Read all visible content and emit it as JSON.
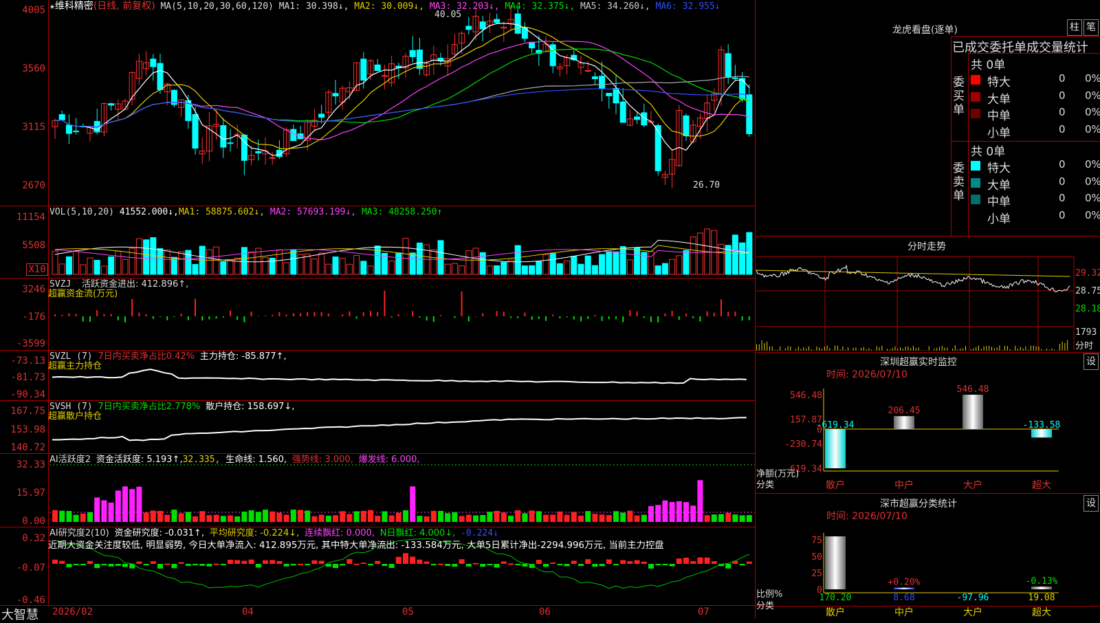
{
  "app": {
    "logo_text": "大智慧"
  },
  "stock": {
    "name": "维科精密",
    "mode": "(日线, 前复权)"
  },
  "price_panel": {
    "ma_params": "MA(5,10,20,30,60,120)",
    "ma1": "MA1: 30.398↓,",
    "ma2": "MA2: 30.009↓,",
    "ma3": "MA3: 32.203↓,",
    "ma4": "MA4: 32.375↓,",
    "ma5": "MA5: 34.260↓,",
    "ma6": "MA6: 32.955↓",
    "high_label": "40.05",
    "low_label": "26.70",
    "y_ticks": [
      "4005",
      "3560",
      "3115",
      "2670"
    ]
  },
  "vol_panel": {
    "title": "VOL(5,10,20)",
    "value": "41552.000↓,",
    "ma1": "MA1: 58875.602↓,",
    "ma2": "MA2: 57693.199↓,",
    "ma3": "MA3: 48258.250↑",
    "y_ticks": [
      "11154",
      "5508"
    ],
    "unit": "X10"
  },
  "svzj_panel": {
    "title": "SVZJ",
    "text": "活跃资金进出: 412.896↑,",
    "subtitle": "超赢资金流(万元)",
    "y_ticks": [
      "3246",
      "-176",
      "-3599"
    ]
  },
  "svzl_panel": {
    "title": "SVZL (7)",
    "ratio": "7日内买卖净占比0.42%",
    "text": "主力持仓: -85.877↑,",
    "subtitle": "超赢主力持仓",
    "y_ticks": [
      "-73.13",
      "-81.73",
      "-90.34"
    ]
  },
  "svsh_panel": {
    "title": "SVSH (7)",
    "ratio": "7日内买卖净占比2.778%",
    "text": "散户持仓: 158.697↓,",
    "subtitle": "超赢散户持仓",
    "y_ticks": [
      "167.75",
      "153.98",
      "140.72"
    ]
  },
  "ai_active_panel": {
    "title": "AI活跃度2",
    "text1": "资金活跃度: 5.193↑,",
    "text2": "32.335,",
    "text3": "生命线: 1.560,",
    "text4": "强势线: 3.000,",
    "text5": "爆发线: 6.000,",
    "y_ticks": [
      "32.33",
      "15.97",
      "0.00"
    ]
  },
  "ai_research_panel": {
    "title": "AI研究度2(10)",
    "text1": "资金研究度: -0.031↑,",
    "text2": "平均研究度: -0.224↓,",
    "text3": "连续飘红: 0.000,",
    "text4": "N日飘红: 4.000↓,",
    "text5": "-0.224↓",
    "commentary": "近期大资金关注度较低, 明显弱势, 今日大单净流入: 412.895万元, 其中特大单净流出: -133.584万元, 大单5日累计净出-2294.996万元, 当前主力控盘",
    "y_ticks": [
      "0.32",
      "-0.07",
      "-0.46"
    ]
  },
  "x_axis": {
    "labels": [
      "2026/02",
      "04",
      "05",
      "06",
      "07"
    ]
  },
  "dragon_tiger": {
    "title": "龙虎看盘(逐单)",
    "btn_bar": "柱",
    "btn_pen": "笔",
    "header": "已成交委托单成交量统计",
    "buy_label": "委买单",
    "sell_label": "委卖单",
    "buy_total": "共 0单",
    "sell_total": "共 0单",
    "buy_rows": [
      {
        "name": "特大",
        "count": "0",
        "pct": "0%",
        "color": "#ff0000"
      },
      {
        "name": "大单",
        "count": "0",
        "pct": "0%",
        "color": "#a00000"
      },
      {
        "name": "中单",
        "count": "0",
        "pct": "0%",
        "color": "#700000"
      },
      {
        "name": "小单",
        "count": "0",
        "pct": "0%",
        "color": ""
      }
    ],
    "sell_rows": [
      {
        "name": "特大",
        "count": "0",
        "pct": "0%",
        "color": "#00ffff"
      },
      {
        "name": "大单",
        "count": "0",
        "pct": "0%",
        "color": "#008b8b"
      },
      {
        "name": "中单",
        "count": "0",
        "pct": "0%",
        "color": "#006f6f"
      },
      {
        "name": "小单",
        "count": "0",
        "pct": "0%",
        "color": ""
      }
    ]
  },
  "intraday": {
    "title": "分时走势",
    "y_ticks": [
      "29.32",
      "28.75",
      "28.18"
    ],
    "vol_tick": "1793",
    "unit": "分时"
  },
  "sz_monitor": {
    "title": "深圳超赢实时监控",
    "btn": "设",
    "time": "时间: 2026/07/10",
    "y_ticks": [
      "546.48",
      "157.87",
      "0",
      "-230.74",
      "-619.34"
    ],
    "axis_label1": "净额(万元)",
    "axis_label2": "分类",
    "bars": [
      {
        "cat": "散户",
        "value": -619.34,
        "label": "-619.34"
      },
      {
        "cat": "中户",
        "value": 206.45,
        "label": "206.45"
      },
      {
        "cat": "大户",
        "value": 546.48,
        "label": "546.48"
      },
      {
        "cat": "超大",
        "value": -133.58,
        "label": "-133.58"
      }
    ]
  },
  "sz_stats": {
    "title": "深市超赢分类统计",
    "btn": "设",
    "time": "时间: 2026/07/10",
    "y_ticks": [
      "75",
      "50",
      "25",
      "0"
    ],
    "axis_label1": "比例%",
    "axis_label2": "分类",
    "bars": [
      {
        "cat": "散户",
        "value": 170.2,
        "label": "170.20",
        "pct": ""
      },
      {
        "cat": "中户",
        "value": 8.68,
        "label": "8.68",
        "pct": "+0.20%"
      },
      {
        "cat": "大户",
        "value": -97.96,
        "label": "-97.96",
        "pct": ""
      },
      {
        "cat": "超大",
        "value": 19.08,
        "label": "19.08",
        "pct": "-0.13%"
      }
    ]
  }
}
